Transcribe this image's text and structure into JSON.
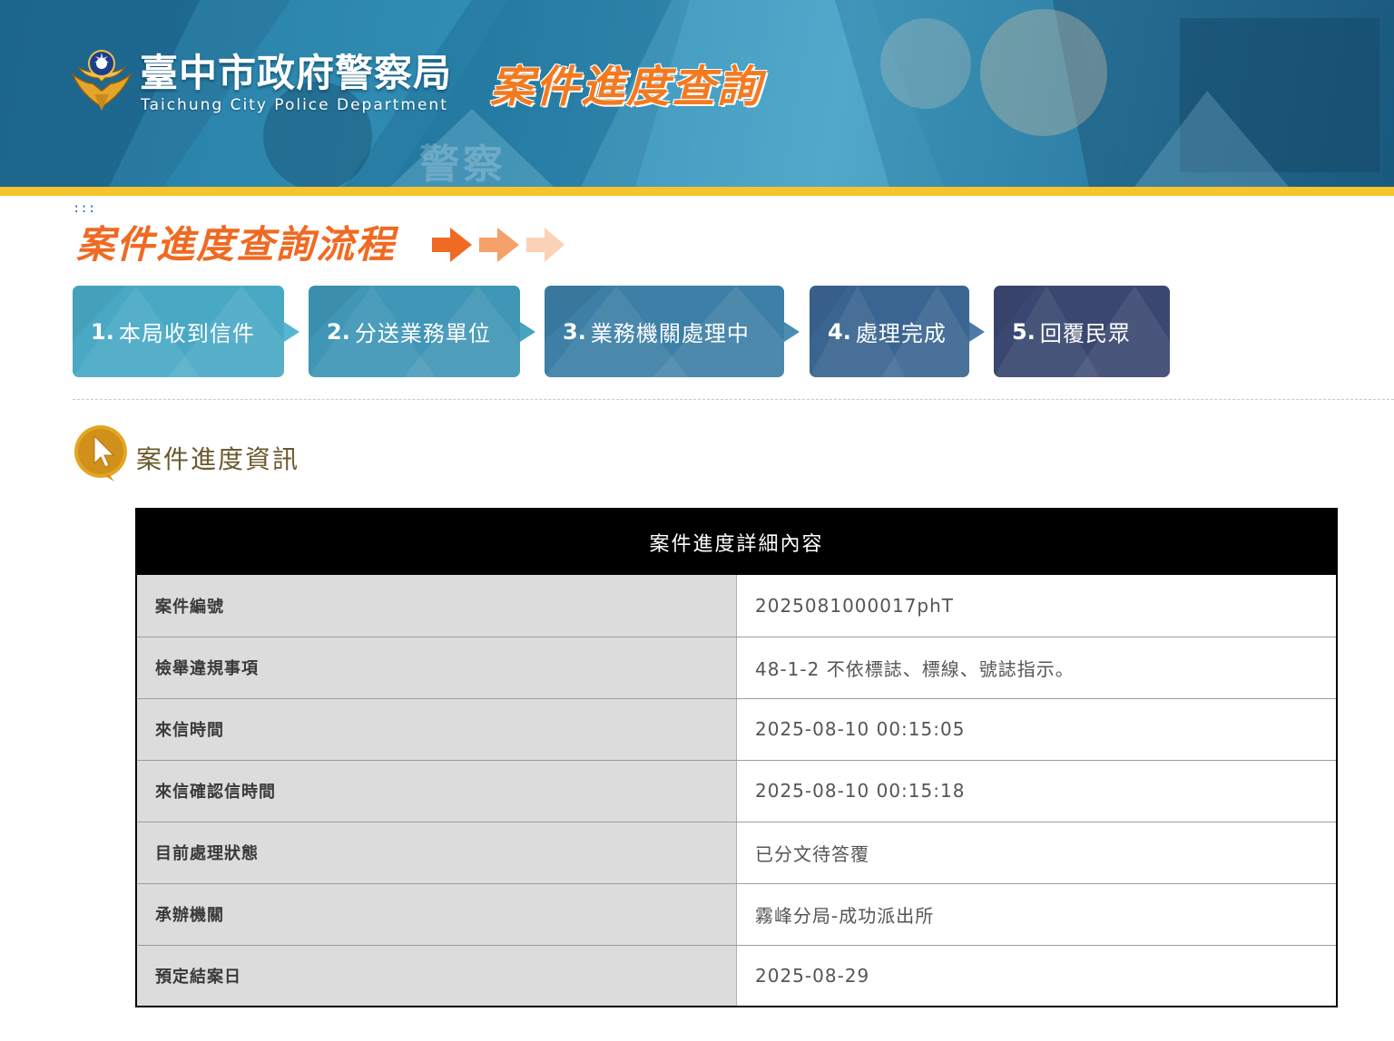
{
  "header": {
    "brand_cn": "臺中市政府警察局",
    "brand_en": "Taichung City Police Department",
    "app_title": "案件進度查詢",
    "background_watermark": "警察",
    "emblem_icon": "police-emblem-icon",
    "colors": {
      "banner": "#2a86ad",
      "accent_bar": "#f6c42d",
      "title_orange": "#f47a20"
    }
  },
  "accesskey": ":::",
  "process": {
    "title": "案件進度查詢流程",
    "arrow_icon": "triple-arrow-icon",
    "steps": [
      {
        "num": "1.",
        "label": "本局收到信件",
        "color": "#49a9c5"
      },
      {
        "num": "2.",
        "label": "分送業務單位",
        "color": "#3f96b6"
      },
      {
        "num": "3.",
        "label": "業務機關處理中",
        "color": "#3d7fa6"
      },
      {
        "num": "4.",
        "label": "處理完成",
        "color": "#3a6591"
      },
      {
        "num": "5.",
        "label": "回覆民眾",
        "color": "#3a4770"
      }
    ]
  },
  "section": {
    "title": "案件進度資訊",
    "icon": "cursor-pointer-icon"
  },
  "details": {
    "caption": "案件進度詳細內容",
    "rows": [
      {
        "label": "案件編號",
        "value": "2025081000017phT"
      },
      {
        "label": "檢舉違規事項",
        "value": "48-1-2 不依標誌、標線、號誌指示。"
      },
      {
        "label": "來信時間",
        "value": "2025-08-10 00:15:05"
      },
      {
        "label": "來信確認信時間",
        "value": "2025-08-10 00:15:18"
      },
      {
        "label": "目前處理狀態",
        "value": "已分文待答覆"
      },
      {
        "label": "承辦機關",
        "value": "霧峰分局-成功派出所"
      },
      {
        "label": "預定結案日",
        "value": "2025-08-29"
      }
    ]
  }
}
